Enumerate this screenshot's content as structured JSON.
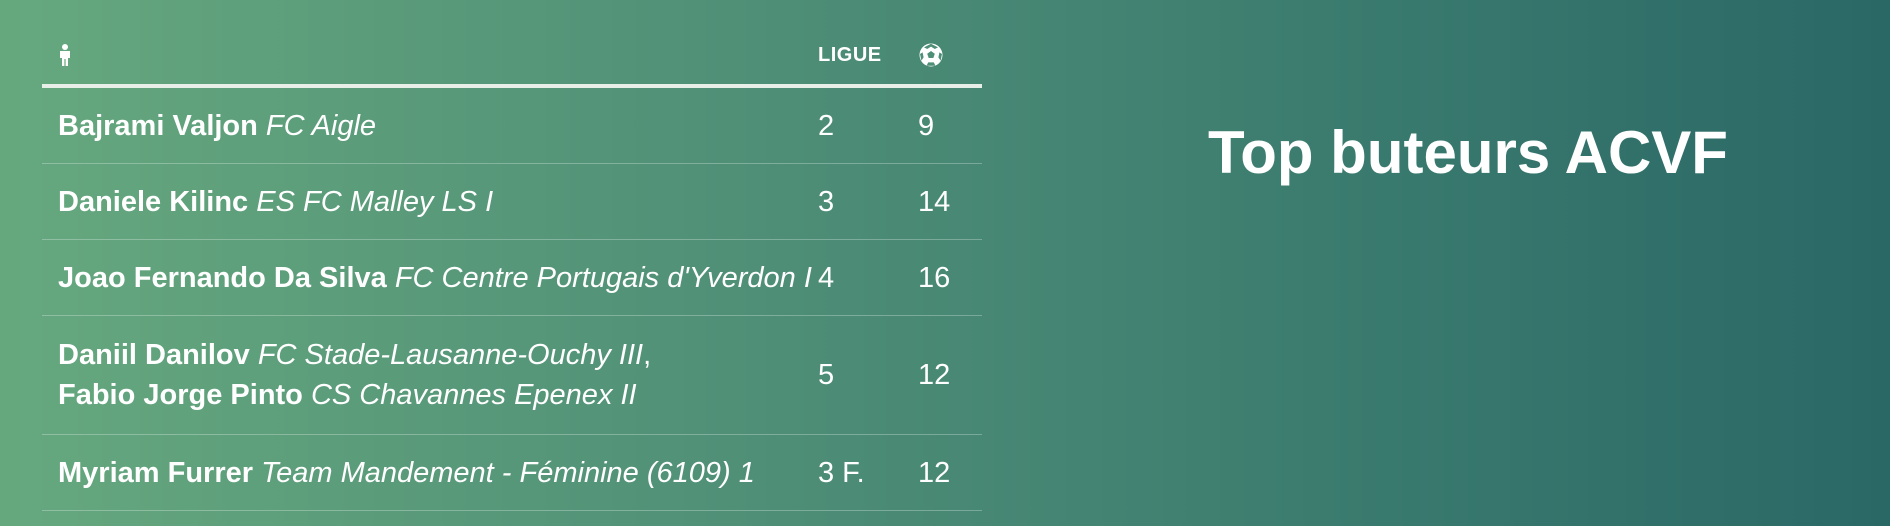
{
  "page": {
    "title": "Top buteurs ACVF"
  },
  "table": {
    "header": {
      "player_icon": "person-icon",
      "league_label": "LIGUE",
      "goals_icon": "soccer-ball-icon"
    },
    "rows": [
      {
        "players": [
          {
            "name": "Bajrami Valjon",
            "club": "FC Aigle"
          }
        ],
        "league": "2",
        "goals": "9"
      },
      {
        "players": [
          {
            "name": "Daniele Kilinc",
            "club": "ES FC Malley LS I"
          }
        ],
        "league": "3",
        "goals": "14"
      },
      {
        "players": [
          {
            "name": "Joao Fernando Da Silva",
            "club": "FC Centre Portugais d'Yverdon I"
          }
        ],
        "league": "4",
        "goals": "16"
      },
      {
        "players": [
          {
            "name": "Daniil Danilov",
            "club": "FC Stade-Lausanne-Ouchy III",
            "sep": ","
          },
          {
            "name": "Fabio Jorge Pinto",
            "club": "CS Chavannes Epenex II"
          }
        ],
        "league": "5",
        "goals": "12"
      },
      {
        "players": [
          {
            "name": "Myriam Furrer",
            "club": "Team Mandement - Féminine (6109) 1"
          }
        ],
        "league": "3 F.",
        "goals": "12"
      }
    ]
  }
}
